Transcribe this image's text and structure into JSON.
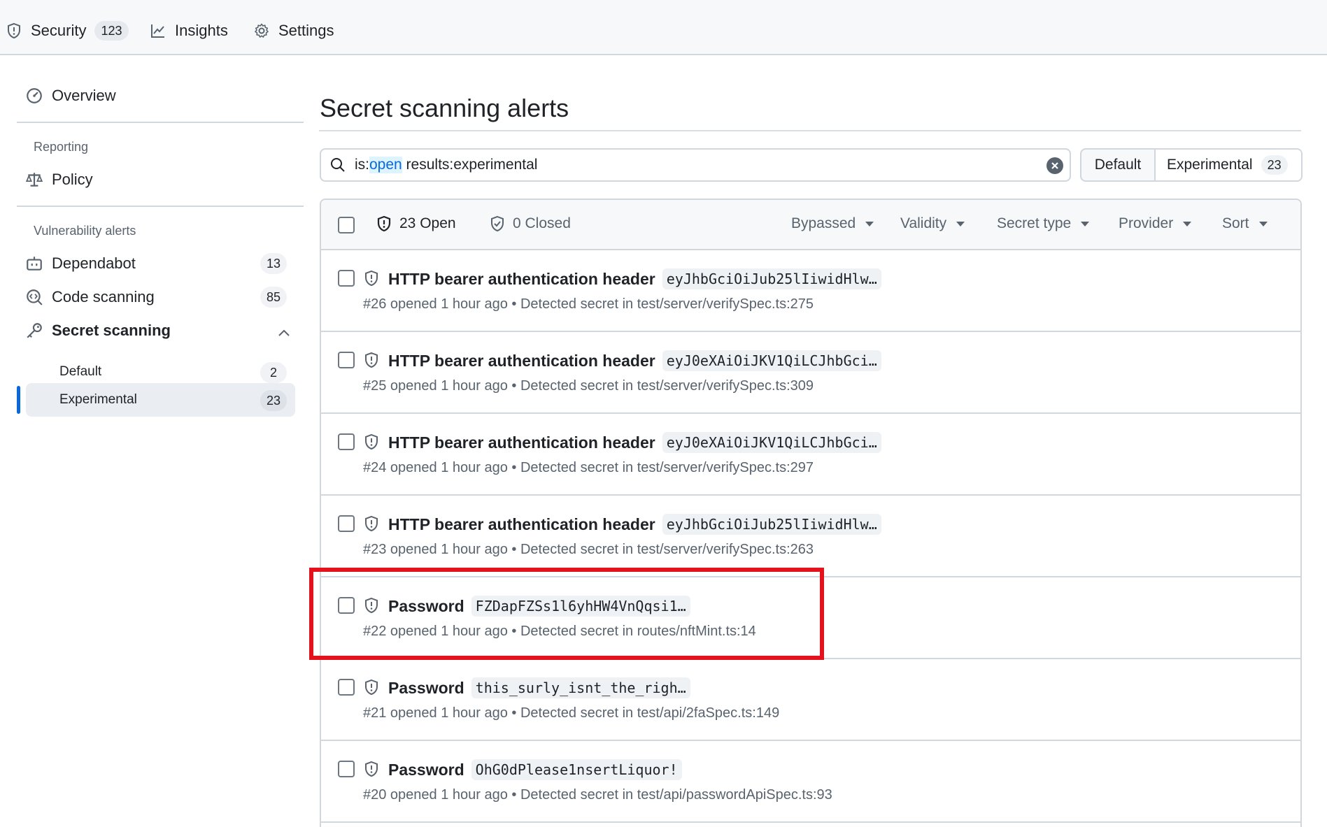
{
  "topnav": {
    "security_label": "Security",
    "security_count": "123",
    "insights_label": "Insights",
    "settings_label": "Settings"
  },
  "sidebar": {
    "overview": "Overview",
    "reporting_heading": "Reporting",
    "policy": "Policy",
    "vuln_heading": "Vulnerability alerts",
    "dependabot": "Dependabot",
    "dependabot_count": "13",
    "code_scanning": "Code scanning",
    "code_scanning_count": "85",
    "secret_scanning": "Secret scanning",
    "default": "Default",
    "default_count": "2",
    "experimental": "Experimental",
    "experimental_count": "23"
  },
  "main": {
    "title": "Secret scanning alerts",
    "search": {
      "prefix": "is:",
      "highlight": "open",
      "suffix": " results:experimental"
    },
    "segment": {
      "default": "Default",
      "experimental": "Experimental",
      "experimental_count": "23"
    },
    "list_header": {
      "open": "23 Open",
      "closed": "0 Closed",
      "filters": [
        "Bypassed",
        "Validity",
        "Secret type",
        "Provider",
        "Sort"
      ]
    },
    "alerts": [
      {
        "title": "HTTP bearer authentication header",
        "secret": "eyJhbGciOiJub25lIiwidHlw…",
        "meta": "#26 opened 1 hour ago • Detected secret in test/server/verifySpec.ts:275"
      },
      {
        "title": "HTTP bearer authentication header",
        "secret": "eyJ0eXAiOiJKV1QiLCJhbGci…",
        "meta": "#25 opened 1 hour ago • Detected secret in test/server/verifySpec.ts:309"
      },
      {
        "title": "HTTP bearer authentication header",
        "secret": "eyJ0eXAiOiJKV1QiLCJhbGci…",
        "meta": "#24 opened 1 hour ago • Detected secret in test/server/verifySpec.ts:297"
      },
      {
        "title": "HTTP bearer authentication header",
        "secret": "eyJhbGciOiJub25lIiwidHlw…",
        "meta": "#23 opened 1 hour ago • Detected secret in test/server/verifySpec.ts:263"
      },
      {
        "title": "Password",
        "secret": "FZDapFZSs1l6yhHW4VnQqsi1…",
        "meta": "#22 opened 1 hour ago • Detected secret in routes/nftMint.ts:14"
      },
      {
        "title": "Password",
        "secret": "this_surly_isnt_the_righ…",
        "meta": "#21 opened 1 hour ago • Detected secret in test/api/2faSpec.ts:149"
      },
      {
        "title": "Password",
        "secret": "OhG0dPlease1nsertLiquor!",
        "meta": "#20 opened 1 hour ago • Detected secret in test/api/passwordApiSpec.ts:93"
      }
    ]
  },
  "colors": {
    "accent": "#0969da",
    "highlight_box": "#e3121c",
    "muted": "#59636e"
  }
}
